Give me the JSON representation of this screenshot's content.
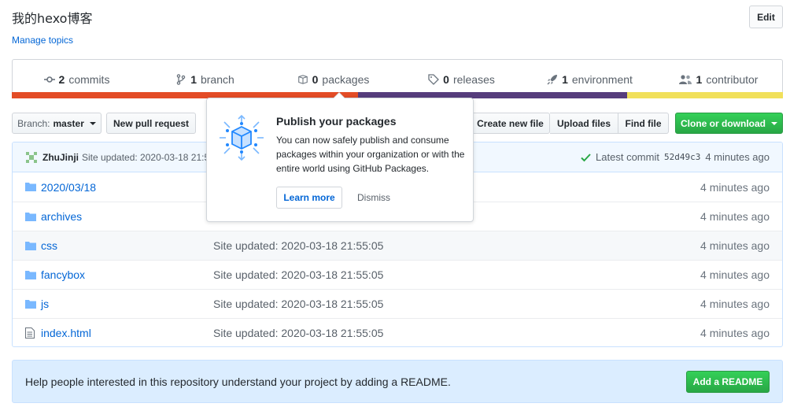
{
  "repo": {
    "description": "我的hexo博客",
    "manage_topics": "Manage topics",
    "edit_label": "Edit"
  },
  "summary": [
    {
      "count": "2",
      "label": "commits",
      "icon": "history-icon"
    },
    {
      "count": "1",
      "label": "branch",
      "icon": "branch-icon"
    },
    {
      "count": "0",
      "label": "packages",
      "icon": "package-icon"
    },
    {
      "count": "0",
      "label": "releases",
      "icon": "tag-icon"
    },
    {
      "count": "1",
      "label": "environment",
      "icon": "rocket-icon"
    },
    {
      "count": "1",
      "label": "contributor",
      "icon": "people-icon"
    }
  ],
  "language_bar_colors": [
    "#e34c26",
    "#563d7c",
    "#f1e05a"
  ],
  "toolbar": {
    "branch_prefix": "Branch:",
    "branch_name": "master",
    "new_pull_request": "New pull request",
    "create_new_file": "Create new file",
    "upload_files": "Upload files",
    "find_file": "Find file",
    "clone_or_download": "Clone or download"
  },
  "commit": {
    "author": "ZhuJinji",
    "message": "Site updated: 2020-03-18 21:5",
    "latest_label": "Latest commit",
    "sha": "52d49c3",
    "age": "4 minutes ago"
  },
  "files": [
    {
      "name": "2020/03/18",
      "type": "folder",
      "message": "",
      "age": "4 minutes ago"
    },
    {
      "name": "archives",
      "type": "folder",
      "message": "",
      "age": "4 minutes ago"
    },
    {
      "name": "css",
      "type": "folder",
      "message": "Site updated: 2020-03-18 21:55:05",
      "age": "4 minutes ago"
    },
    {
      "name": "fancybox",
      "type": "folder",
      "message": "Site updated: 2020-03-18 21:55:05",
      "age": "4 minutes ago"
    },
    {
      "name": "js",
      "type": "folder",
      "message": "Site updated: 2020-03-18 21:55:05",
      "age": "4 minutes ago"
    },
    {
      "name": "index.html",
      "type": "file",
      "message": "Site updated: 2020-03-18 21:55:05",
      "age": "4 minutes ago"
    }
  ],
  "readme": {
    "text": "Help people interested in this repository understand your project by adding a README.",
    "button": "Add a README"
  },
  "popover": {
    "title": "Publish your packages",
    "text": "You can now safely publish and consume packages within your organization or with the entire world using GitHub Packages.",
    "learn_more": "Learn more",
    "dismiss": "Dismiss"
  },
  "colors": {
    "link": "#0366d6",
    "primary_green": "#28a745",
    "blue_tint": "#f1f8ff"
  }
}
